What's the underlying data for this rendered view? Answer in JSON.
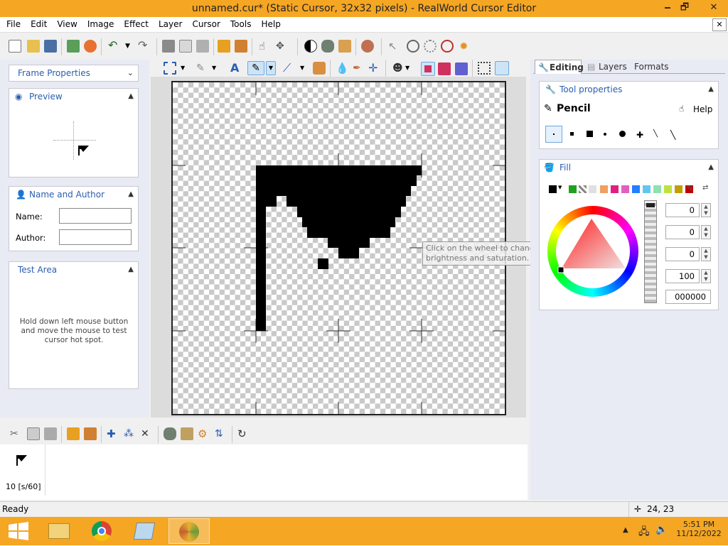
{
  "window": {
    "title": "unnamed.cur* (Static Cursor, 32x32 pixels) - RealWorld Cursor Editor",
    "minimize": "🗕",
    "maximize": "🗗",
    "close": "✕",
    "doc_close": "✕"
  },
  "menu": [
    "File",
    "Edit",
    "View",
    "Image",
    "Effect",
    "Layer",
    "Cursor",
    "Tools",
    "Help"
  ],
  "left": {
    "frame_properties": "Frame Properties",
    "preview": "Preview",
    "name_author": "Name and Author",
    "name_label": "Name:",
    "author_label": "Author:",
    "name_value": "",
    "author_value": "",
    "test_area": "Test Area",
    "test_hint": "Hold down left mouse button and move the mouse to test cursor hot spot."
  },
  "right": {
    "tabs": [
      "Editing",
      "Layers",
      "Formats"
    ],
    "tool_properties": "Tool properties",
    "tool_name": "Pencil",
    "help": "Help",
    "fill": "Fill",
    "spin_values": [
      "0",
      "0",
      "0",
      "100"
    ],
    "hex": "000000",
    "tooltip": "Click on the wheel to change hue, click inside the triangle to change brightness and saturation."
  },
  "colors": {
    "titlebar": "#f5a623",
    "accent": "#2a5db0",
    "swatches": [
      "#000000",
      "#ffffff",
      "#c0c0c0",
      "#20a020",
      "#808080",
      "#e0e0e0",
      "#ffffff",
      "#f08040",
      "#e02080",
      "#e060c0",
      "#2080ff",
      "#40c0e0",
      "#80e0a0",
      "#c0e040",
      "#e0e020",
      "#c00000"
    ]
  },
  "frames": [
    {
      "label": "10 [s/60]"
    }
  ],
  "status": {
    "text": "Ready",
    "coords": "24, 23"
  },
  "taskbar": {
    "time": "5:51 PM",
    "date": "11/12/2022"
  }
}
